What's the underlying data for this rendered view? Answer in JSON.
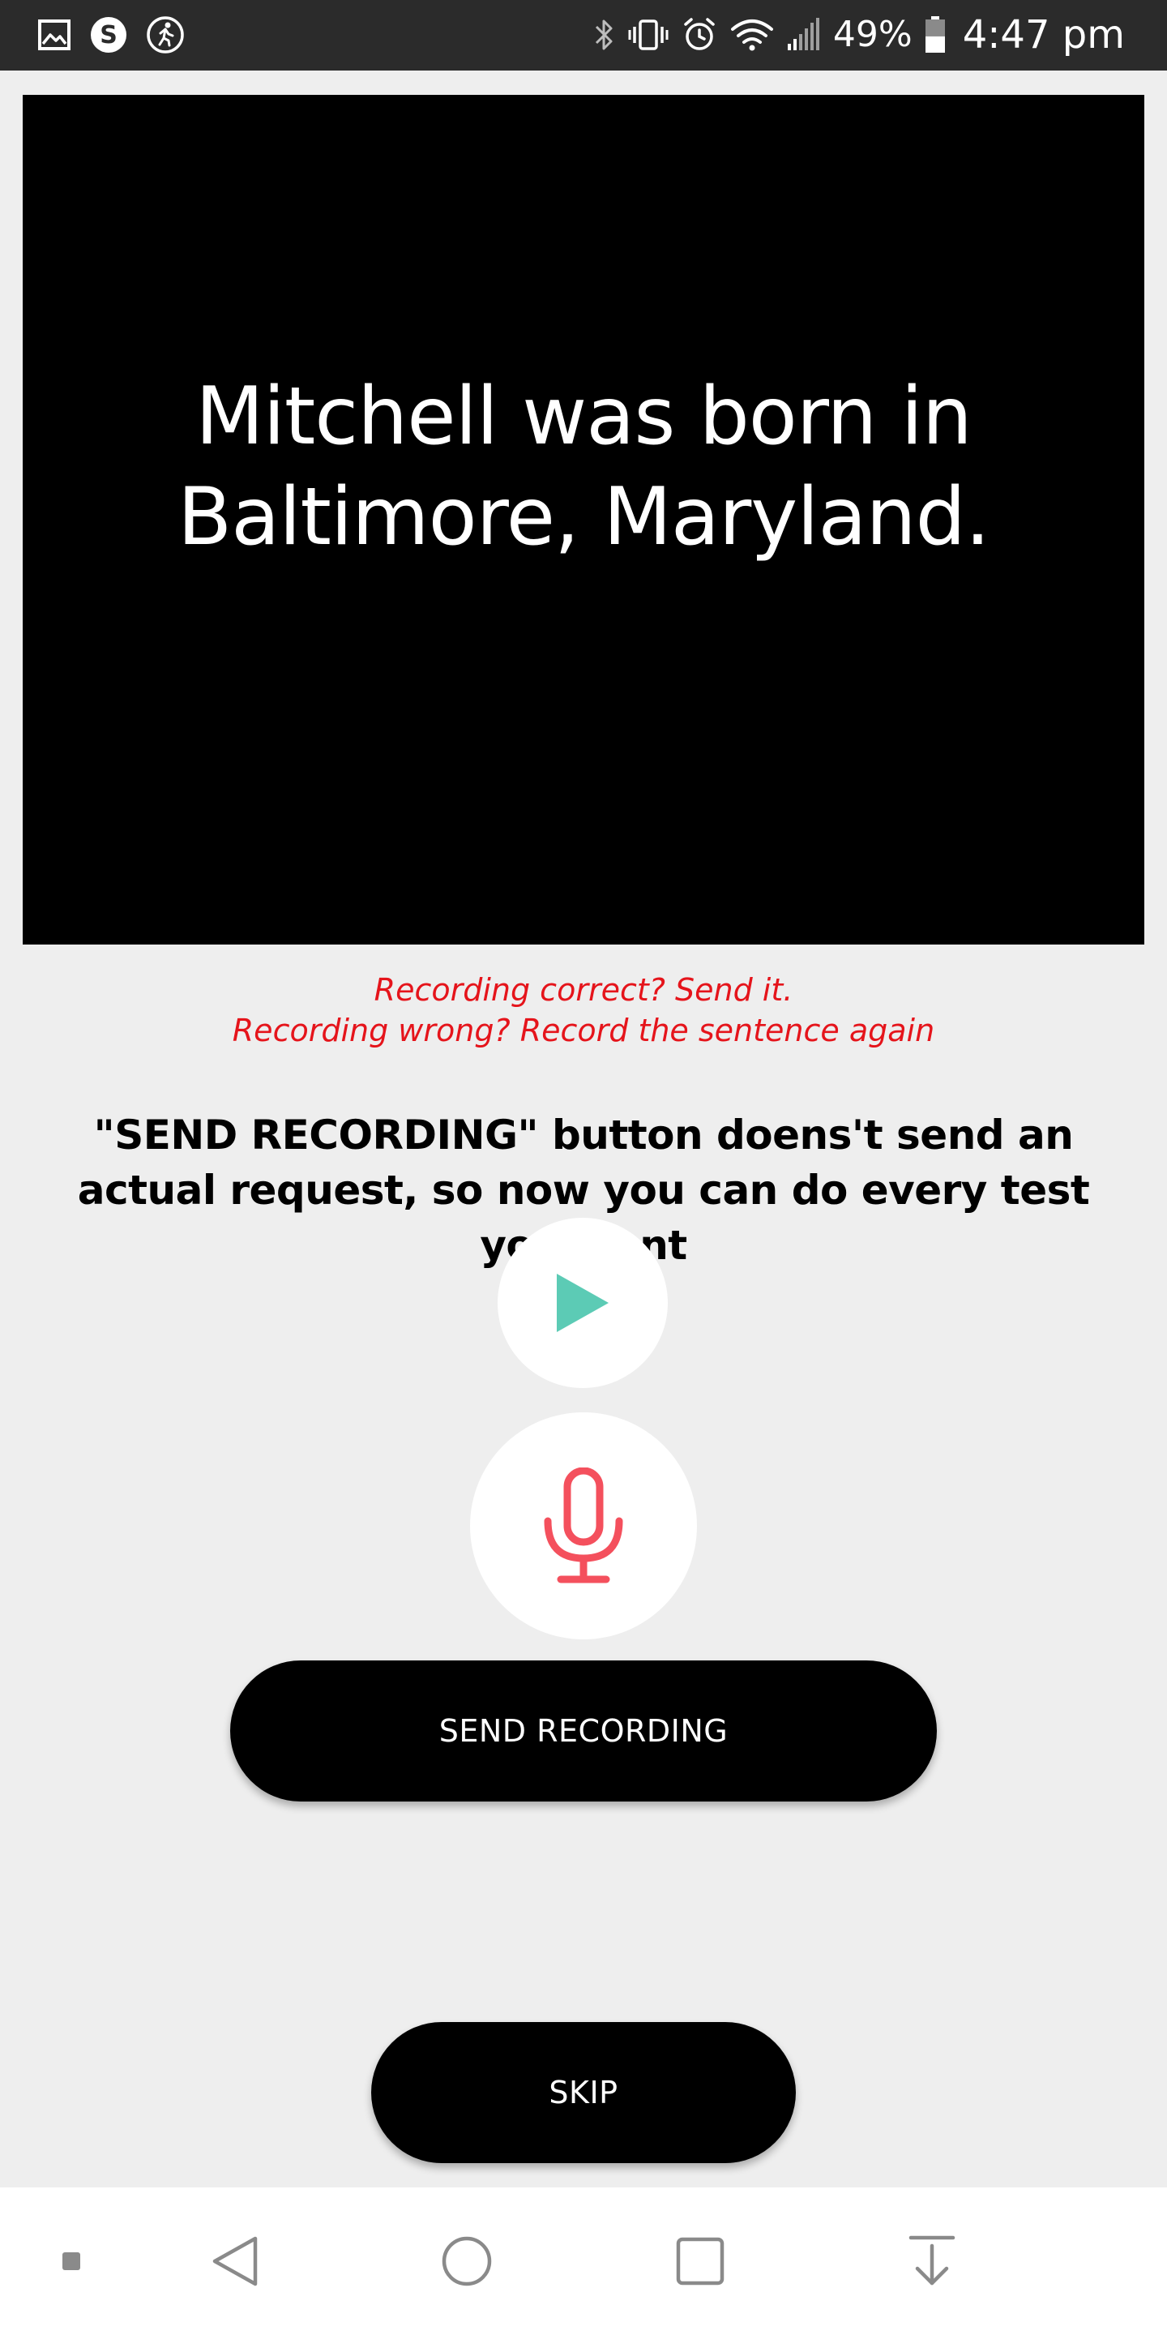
{
  "status_bar": {
    "left_icons": [
      "gallery-icon",
      "s-app-icon",
      "walking-icon"
    ],
    "right_icons": [
      "bluetooth-icon",
      "vibrate-icon",
      "alarm-icon",
      "wifi-icon",
      "signal-icon"
    ],
    "battery_percent": "49%",
    "battery_level": 0.49,
    "time": "4:47 pm"
  },
  "sentence": {
    "text": "Mitchell was born in Baltimore, Maryland."
  },
  "hint": {
    "line1": "Recording correct? Send it.",
    "line2": "Recording wrong? Record the sentence again"
  },
  "info": {
    "text": "\"SEND RECORDING\" button doens't send an actual request, so now you can do every test you want"
  },
  "buttons": {
    "play_icon": "play-icon",
    "mic_icon": "microphone-icon",
    "send_label": "SEND RECORDING",
    "skip_label": "SKIP"
  },
  "nav_bar": {
    "items": [
      "menu-dot-icon",
      "back-icon",
      "home-icon",
      "recents-icon",
      "download-icon"
    ]
  },
  "colors": {
    "status_bar_bg": "#2b2b2b",
    "page_bg": "#eeeeee",
    "panel_bg": "#000000",
    "hint_red": "#e5141b",
    "play_teal": "#5ccbb5",
    "mic_red": "#f4505d",
    "button_bg": "#000000",
    "nav_bg": "#ffffff"
  }
}
